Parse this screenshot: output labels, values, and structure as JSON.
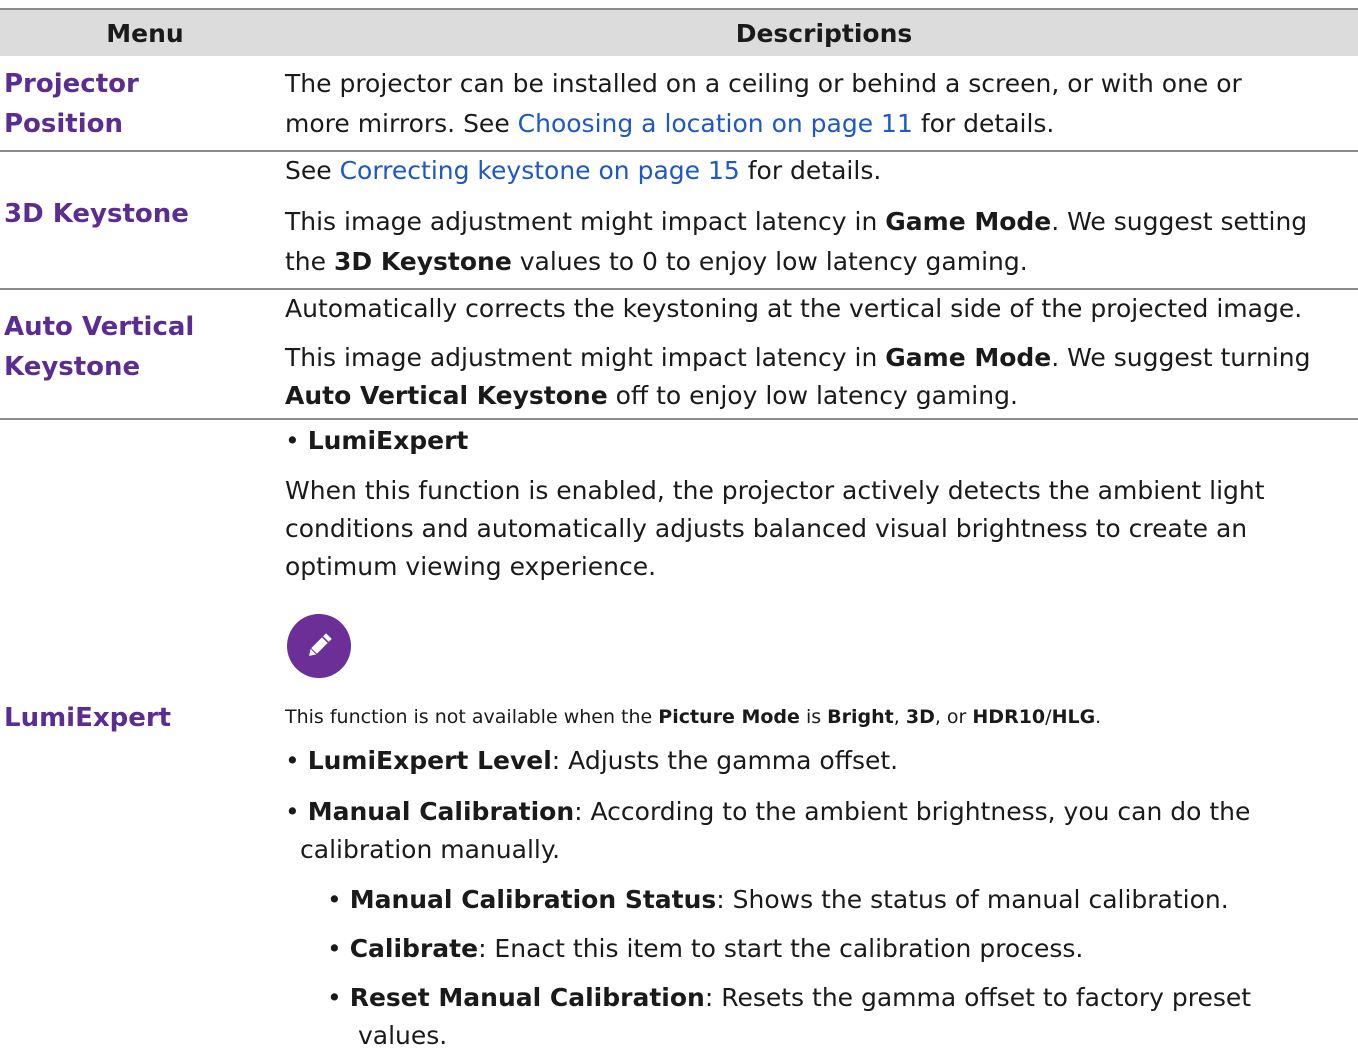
{
  "header": {
    "menu": "Menu",
    "descriptions": "Descriptions"
  },
  "rows": {
    "projector_position": {
      "menu_line1": "Projector",
      "menu_line2": "Position",
      "desc_line1": "The projector can be installed on a ceiling or behind a screen, or with one or",
      "desc_line2_pre": "more mirrors. See ",
      "desc_link": "Choosing a location on page 11",
      "desc_line2_post": " for details."
    },
    "keystone_3d": {
      "menu": "3D Keystone",
      "p1_pre": "See ",
      "p1_link": "Correcting keystone on page 15",
      "p1_post": " for details.",
      "p2_line1_pre": "This image adjustment might impact latency in ",
      "p2_line1_bold": "Game Mode",
      "p2_line1_post": ". We suggest setting",
      "p2_line2_pre": "the ",
      "p2_line2_bold": "3D Keystone",
      "p2_line2_post": " values to 0 to enjoy low latency gaming."
    },
    "auto_vertical_keystone": {
      "menu_line1": "Auto Vertical",
      "menu_line2": "Keystone",
      "p1": "Automatically corrects the keystoning at the vertical side of the projected image.",
      "p2_line1_pre": "This image adjustment might impact latency in ",
      "p2_line1_bold": "Game Mode",
      "p2_line1_post": ". We suggest turning",
      "p2_line2_bold": "Auto Vertical Keystone",
      "p2_line2_post": " off to enjoy low latency gaming."
    },
    "lumiexpert": {
      "menu": "LumiExpert",
      "bullet": "•",
      "b1_bold": "LumiExpert",
      "intro_line1": "When this function is enabled, the projector actively detects the ambient light",
      "intro_line2": "conditions and automatically adjusts balanced visual brightness to create an",
      "intro_line3": "optimum viewing experience.",
      "note": {
        "pre": "This function is not available when the ",
        "b1": "Picture Mode",
        "mid1": " is ",
        "b2": "Bright",
        "mid2": ", ",
        "b3": "3D",
        "mid3": ", or ",
        "b4": "HDR10",
        "slash": "/",
        "b5": "HLG",
        "end": "."
      },
      "level_bold": "LumiExpert Level",
      "level_text": ": Adjusts the gamma offset.",
      "manual_bold": "Manual Calibration",
      "manual_text1": ": According to the ambient brightness, you can do the",
      "manual_text2": "calibration manually.",
      "status_bold": "Manual Calibration Status",
      "status_text": ": Shows the status of manual calibration.",
      "calibrate_bold": "Calibrate",
      "calibrate_text": ": Enact this item to start the calibration process.",
      "reset_bold": "Reset Manual Calibration",
      "reset_text1": ": Resets the gamma offset to factory preset",
      "reset_text2": "values."
    }
  }
}
